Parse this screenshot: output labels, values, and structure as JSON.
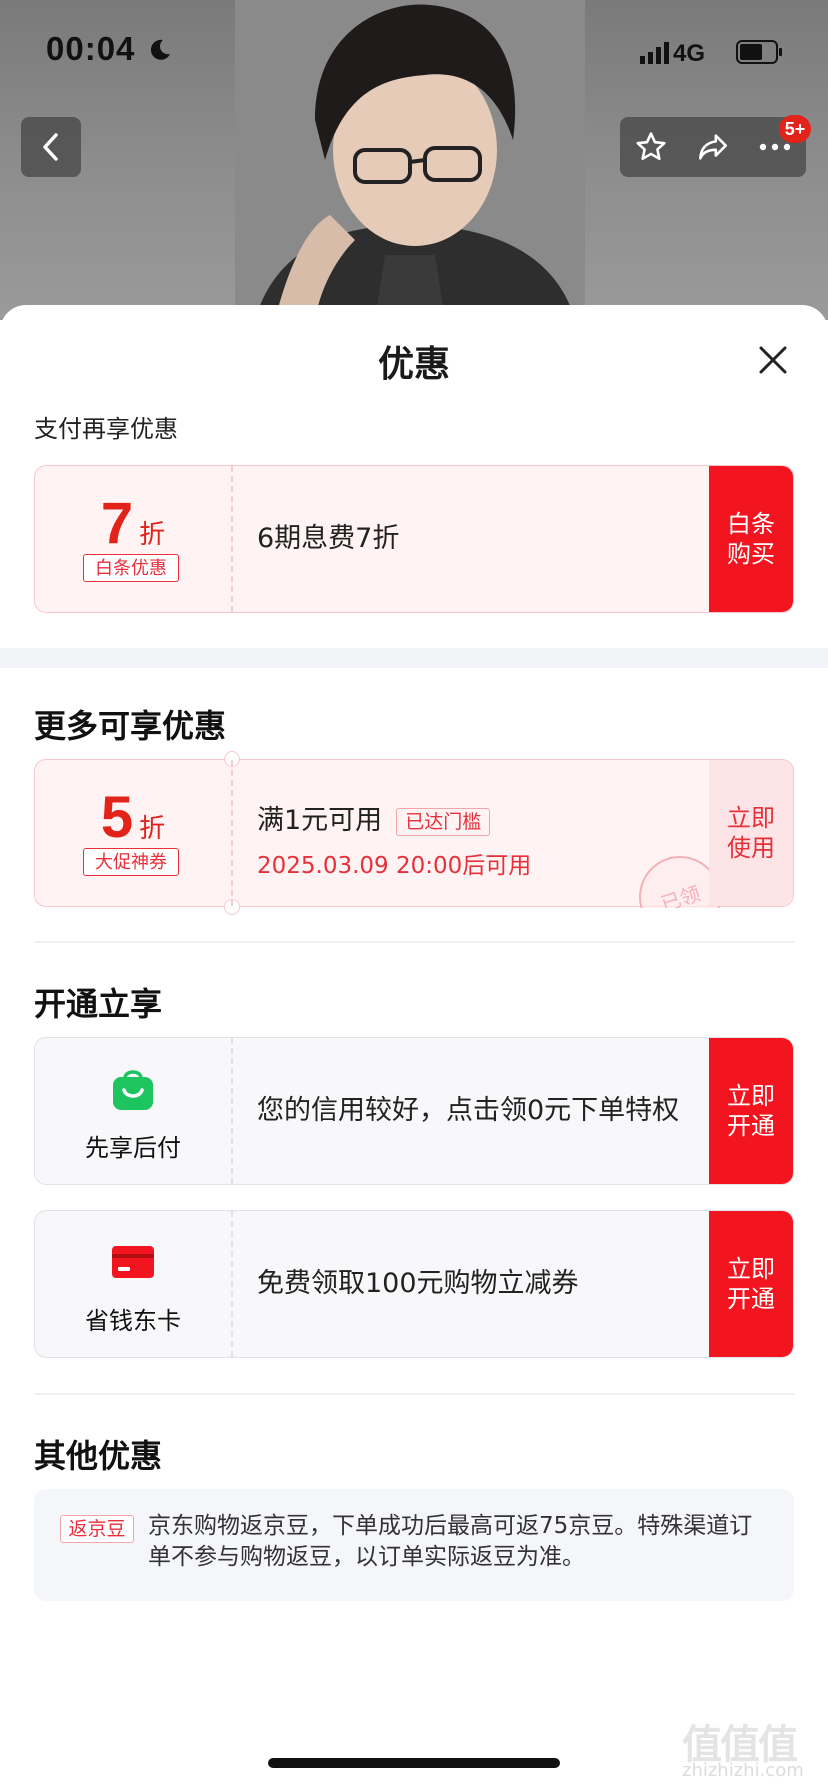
{
  "status_bar": {
    "time": "00:04",
    "network": "4G"
  },
  "nav": {
    "cart_badge": "5+"
  },
  "sheet": {
    "title": "优惠",
    "pay_section": {
      "title": "支付再享优惠",
      "card": {
        "discount": "7",
        "unit": "折",
        "tag": "白条优惠",
        "description": "6期息费7折",
        "action": "白条购买"
      }
    },
    "more_section": {
      "title": "更多可享优惠",
      "card": {
        "discount": "5",
        "unit": "折",
        "tag": "大促神券",
        "condition": "满1元可用",
        "condition_tag": "已达门槛",
        "valid_from": "2025.03.09 20:00后可用",
        "stamp": "已领",
        "action": "立即使用"
      }
    },
    "open_section": {
      "title": "开通立享",
      "cards": [
        {
          "icon": "shopping-bag-icon",
          "label": "先享后付",
          "description": "您的信用较好，点击领0元下单特权",
          "action": "立即开通"
        },
        {
          "icon": "credit-card-icon",
          "label": "省钱东卡",
          "description": "免费领取100元购物立减券",
          "action": "立即开通"
        }
      ]
    },
    "other_section": {
      "title": "其他优惠",
      "tag": "返京豆",
      "text": "京东购物返京豆，下单成功后最高可返75京豆。特殊渠道订单不参与购物返豆，以订单实际返豆为准。"
    }
  },
  "watermark": {
    "logo": "值值值",
    "site": "zhizhizhi.com"
  },
  "colors": {
    "accent": "#f2151f",
    "accent_text": "#e8303b",
    "green_icon": "#1ec45f"
  }
}
